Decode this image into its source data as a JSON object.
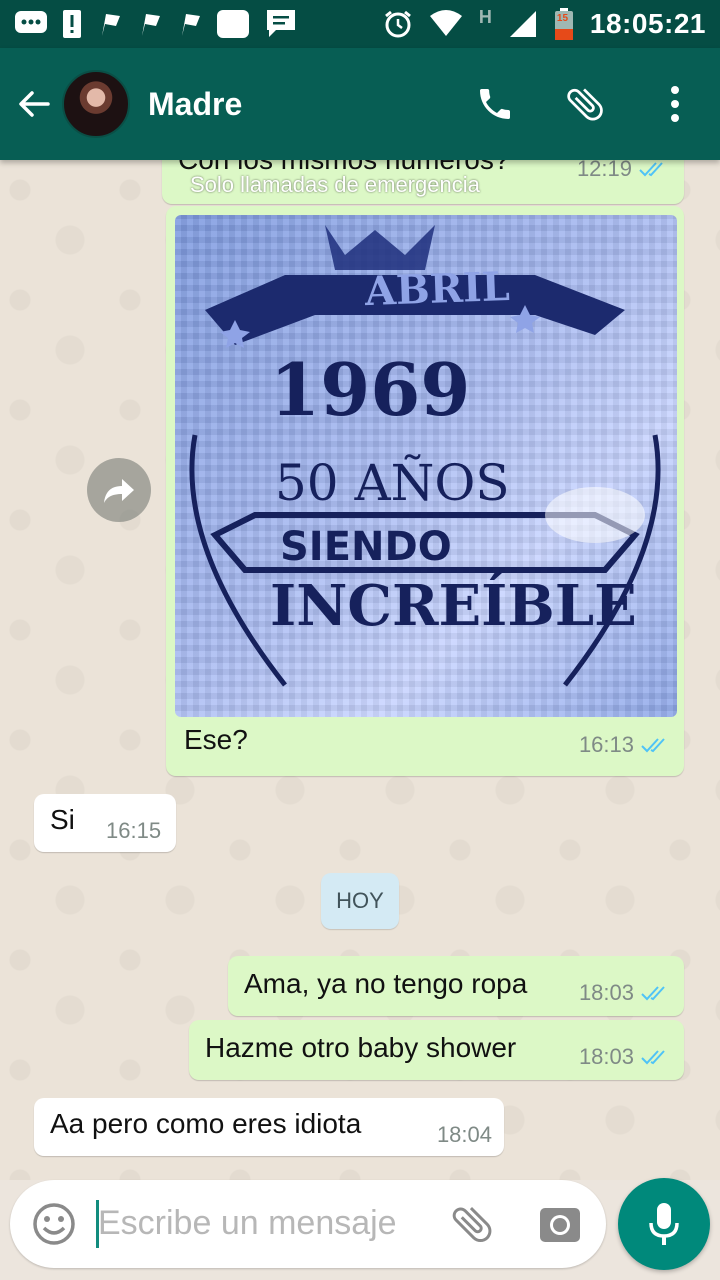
{
  "status_bar": {
    "time": "18:05:21",
    "network_letter": "H",
    "battery_level": "15",
    "icons": [
      "chat-icon",
      "alert-icon",
      "flag-icon",
      "flag-icon",
      "flag-icon",
      "image-icon",
      "message-icon",
      "alarm-icon",
      "wifi-icon",
      "signal-icon",
      "battery-icon"
    ]
  },
  "header": {
    "contact_name": "Madre",
    "icons": [
      "back-arrow-icon",
      "phone-icon",
      "paperclip-icon",
      "more-vert-icon"
    ]
  },
  "messages": [
    {
      "direction": "out",
      "text": "Con los mismos números?",
      "time": "12:19",
      "status": "read"
    },
    {
      "direction": "out",
      "type": "image",
      "caption": "Ese?",
      "time": "16:13",
      "status": "read",
      "image_text": {
        "top": "ABRIL",
        "year": "1969",
        "line1": "50 AÑOS",
        "line2": "SIENDO",
        "line3": "INCREÍBLE"
      }
    },
    {
      "direction": "in",
      "text": "Si",
      "time": "16:15"
    },
    {
      "direction": "out",
      "text": "Ama, ya no tengo ropa",
      "time": "18:03",
      "status": "read"
    },
    {
      "direction": "out",
      "text": "Hazme otro baby shower",
      "time": "18:03",
      "status": "read"
    },
    {
      "direction": "in",
      "text": "Aa pero como eres idiota",
      "time": "18:04"
    }
  ],
  "overlay_notice": "Solo llamadas de emergencia",
  "date_separator": "HOY",
  "composer": {
    "placeholder": "Escribe un mensaje",
    "icons": [
      "emoji-icon",
      "paperclip-icon",
      "camera-icon",
      "microphone-icon"
    ]
  },
  "colors": {
    "header": "#075e54",
    "status_bar": "#054d44",
    "outgoing_bubble": "#dcf8c6",
    "incoming_bubble": "#ffffff",
    "read_ticks": "#4fc3f7",
    "fab": "#00897b"
  }
}
